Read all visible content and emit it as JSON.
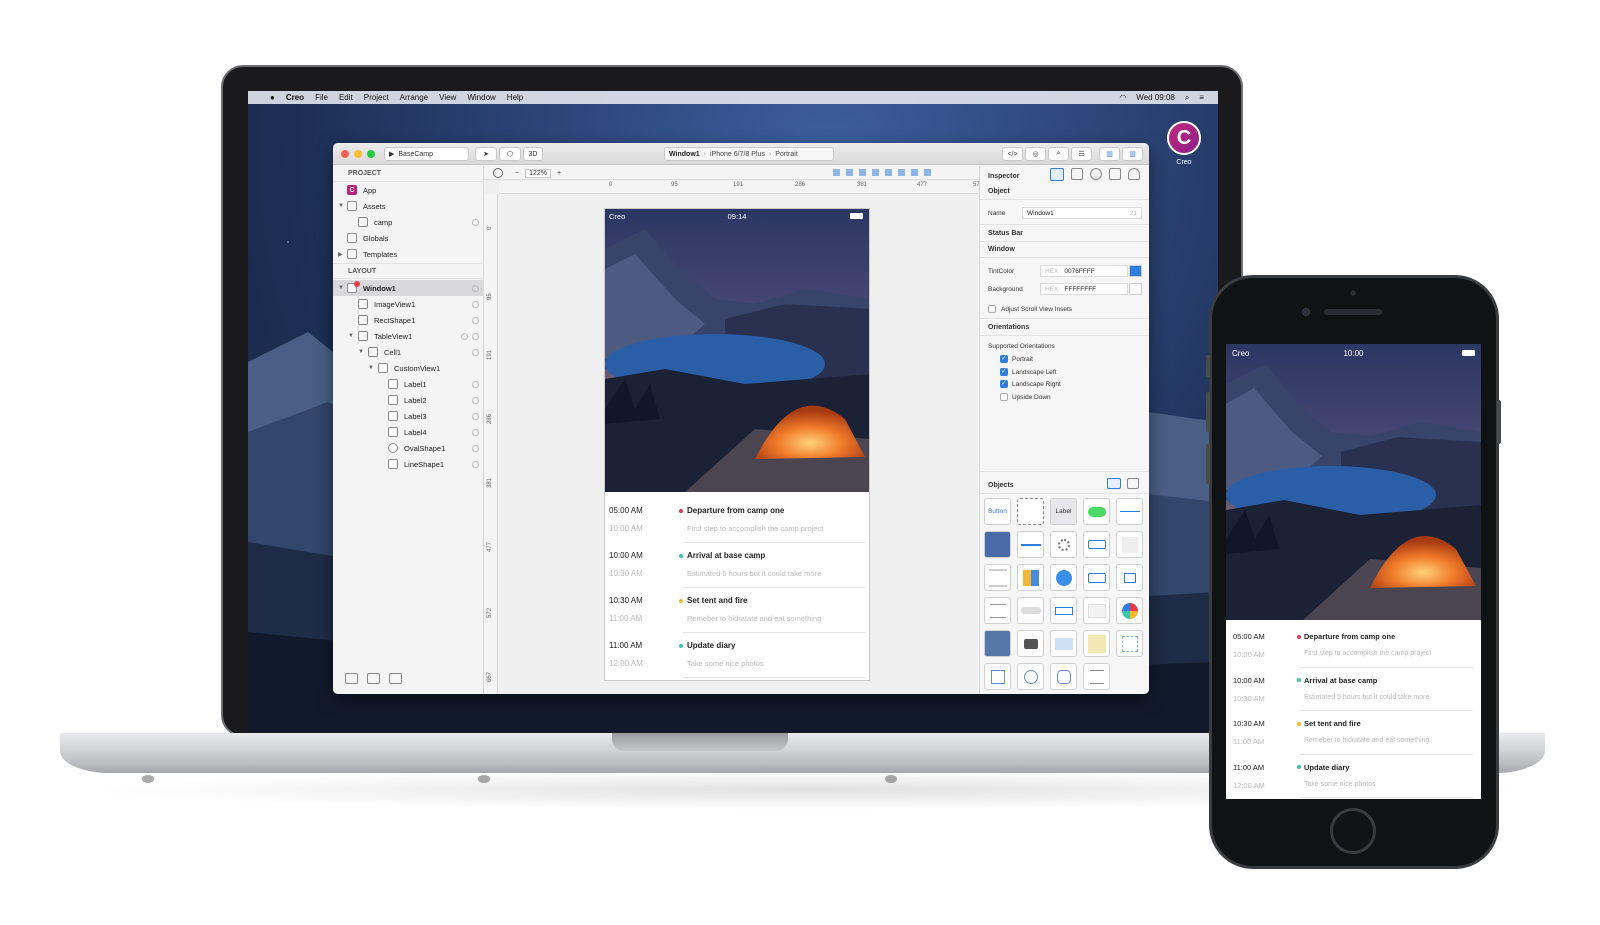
{
  "menubar": {
    "app_name": "Creo",
    "items": [
      "File",
      "Edit",
      "Project",
      "Arrange",
      "View",
      "Window",
      "Help"
    ],
    "clock": "Wed 09:08"
  },
  "desktop": {
    "icon_letter": "C",
    "icon_label": "Creo"
  },
  "toolbar": {
    "project_name": "BaseCamp",
    "view_3d": "3D",
    "breadcrumb": [
      "Window1",
      "iPhone 6/7/8 Plus",
      "Portrait"
    ]
  },
  "left_panel": {
    "project_header": "PROJECT",
    "layout_header": "LAYOUT",
    "project_items": [
      {
        "label": "App"
      },
      {
        "label": "Assets"
      },
      {
        "label": "camp"
      },
      {
        "label": "Globals"
      },
      {
        "label": "Templates"
      }
    ],
    "layout_items": [
      {
        "label": "Window1"
      },
      {
        "label": "ImageView1"
      },
      {
        "label": "RectShape1"
      },
      {
        "label": "TableView1"
      },
      {
        "label": "Cell1"
      },
      {
        "label": "CustomView1"
      },
      {
        "label": "Label1"
      },
      {
        "label": "Label2"
      },
      {
        "label": "Label3"
      },
      {
        "label": "Label4"
      },
      {
        "label": "OvalShape1"
      },
      {
        "label": "LineShape1"
      }
    ]
  },
  "canvas": {
    "zoom": "122%",
    "zoom_minus": "−",
    "zoom_plus": "+",
    "hruler": [
      "0",
      "95",
      "191",
      "286",
      "381",
      "477",
      "57"
    ],
    "vruler": [
      "0",
      "95",
      "191",
      "286",
      "381",
      "477",
      "572",
      "667"
    ]
  },
  "preview_laptop": {
    "carrier": "Creo",
    "time": "09:14",
    "events": [
      {
        "start": "05:00 AM",
        "end": "10:00 AM",
        "title": "Departure from camp one",
        "subtitle": "First step to accomplish the camp project",
        "color": "#e53b4a"
      },
      {
        "start": "10:00 AM",
        "end": "10:30 AM",
        "title": "Arrival at base camp",
        "subtitle": "Estimated 5 hours but it could take more",
        "color": "#3cc6a8"
      },
      {
        "start": "10:30 AM",
        "end": "11:00 AM",
        "title": "Set tent and fire",
        "subtitle": "Remeber to hidratate and eat something",
        "color": "#f2b92b"
      },
      {
        "start": "11:00 AM",
        "end": "12:00 AM",
        "title": "Update diary",
        "subtitle": "Take some nice photos",
        "color": "#3cc6a8"
      }
    ]
  },
  "preview_phone": {
    "carrier": "Creo",
    "time": "10:00",
    "events": [
      {
        "start": "05:00 AM",
        "end": "10:00 AM",
        "title": "Departure from camp one",
        "subtitle": "First step to accomplish the camp project",
        "color": "#e53b4a"
      },
      {
        "start": "10:00 AM",
        "end": "10:30 AM",
        "title": "Arrival at base camp",
        "subtitle": "Estimated 5 hours but it could take more",
        "color": "#3cc6a8"
      },
      {
        "start": "10:30 AM",
        "end": "11:00 AM",
        "title": "Set tent and fire",
        "subtitle": "Remeber to hidratate and eat something",
        "color": "#f2b92b"
      },
      {
        "start": "11:00 AM",
        "end": "12:00 AM",
        "title": "Update diary",
        "subtitle": "Take some nice photos",
        "color": "#3cc6a8"
      }
    ]
  },
  "inspector": {
    "title": "Inspector",
    "object_header": "Object",
    "name_label": "Name",
    "name_value": "Window1",
    "name_count": "21",
    "status_bar_header": "Status Bar",
    "window_header": "Window",
    "tint_label": "TintColor",
    "hex_prefix": "HEX",
    "tint_value": "0076FFFF",
    "tint_color": "#2f7de1",
    "bg_label": "Background",
    "bg_value": "FFFFFFFF",
    "adjust_label": "Adjust Scroll View Insets",
    "orientations_header": "Orientations",
    "supported_label": "Supported Orientations",
    "orientations": [
      {
        "label": "Portrait",
        "checked": true
      },
      {
        "label": "Landscape Left",
        "checked": true
      },
      {
        "label": "Landscape Right",
        "checked": true
      },
      {
        "label": "Upside Down",
        "checked": false
      }
    ],
    "objects_header": "Objects",
    "object_button_label": "Button",
    "object_label_label": "Label"
  }
}
